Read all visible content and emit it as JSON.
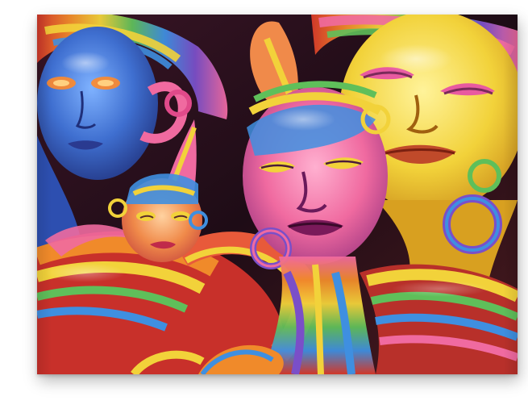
{
  "artwork": {
    "subject": "surreal-glossy-rainbow-mannequin-heads",
    "palette": {
      "background": "#2a1220",
      "blue": "#3f6fd0",
      "yellow": "#f2d23a",
      "pink": "#f06aa0",
      "orange": "#f08a2a",
      "red": "#d83a2a",
      "green": "#5fbf5a",
      "purple": "#7a4fc8"
    },
    "figures": [
      {
        "name": "blue-face",
        "color": "blue"
      },
      {
        "name": "yellow-face",
        "color": "yellow"
      },
      {
        "name": "center-rainbow-face",
        "color": "pink"
      },
      {
        "name": "small-clown-face",
        "color": "orange"
      }
    ]
  }
}
